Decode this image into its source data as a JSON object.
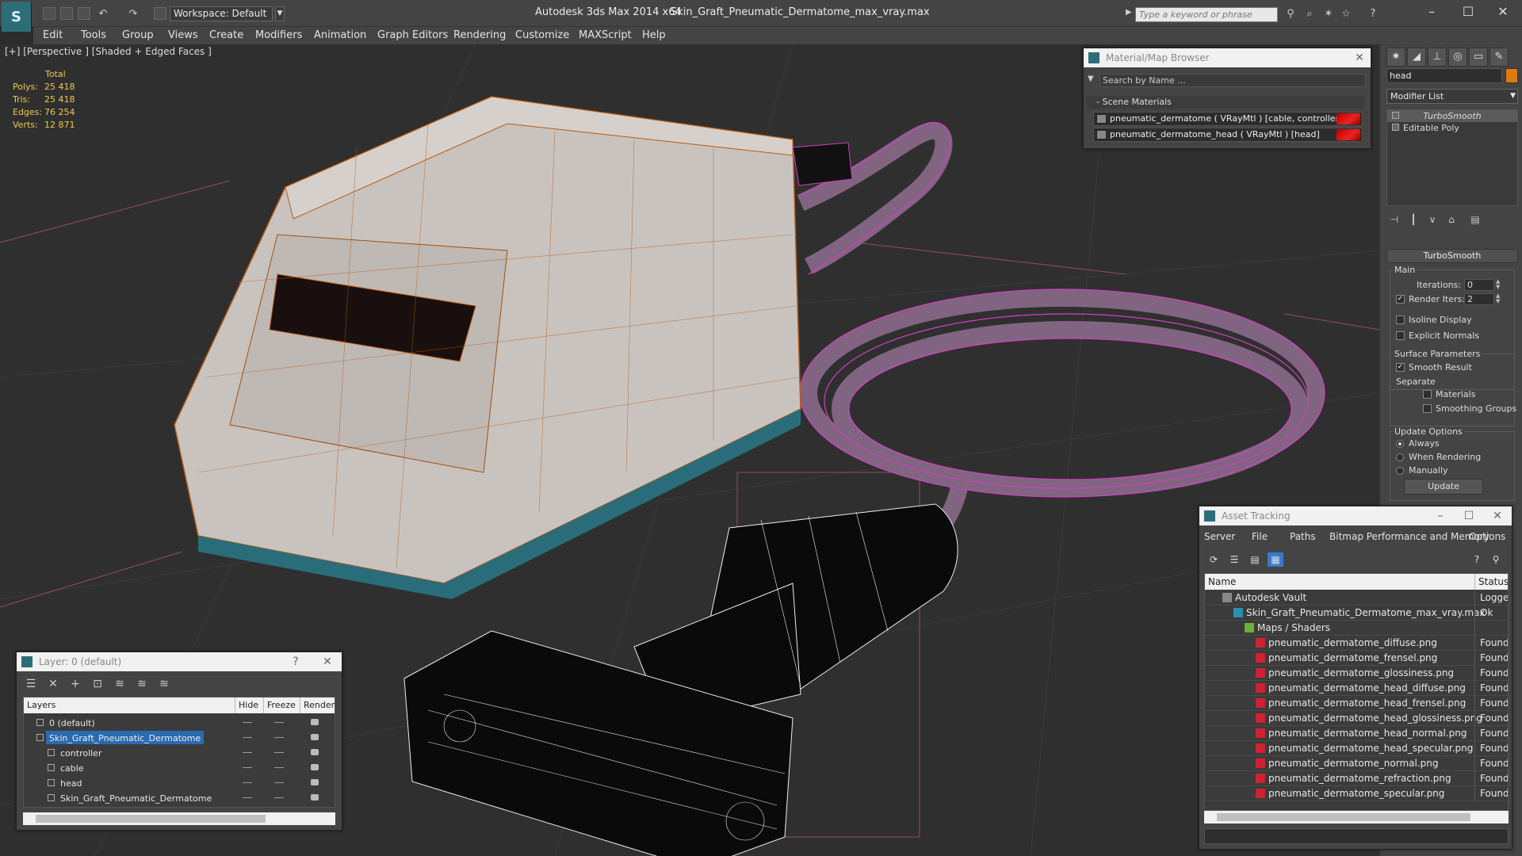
{
  "titlebar": {
    "workspace": "Workspace: Default",
    "app_title": "Autodesk 3ds Max  2014 x64",
    "file_title": "Skin_Graft_Pneumatic_Dermatome_max_vray.max",
    "search_placeholder": "Type a keyword or phrase"
  },
  "menu": [
    "Edit",
    "Tools",
    "Group",
    "Views",
    "Create",
    "Modifiers",
    "Animation",
    "Graph Editors",
    "Rendering",
    "Customize",
    "MAXScript",
    "Help"
  ],
  "viewport": {
    "label": "[+] [Perspective ] [Shaded + Edged Faces ]",
    "stats": {
      "header": "Total",
      "rows": [
        {
          "k": "Polys:",
          "v": "25 418"
        },
        {
          "k": "Tris:",
          "v": "25 418"
        },
        {
          "k": "Edges:",
          "v": "76 254"
        },
        {
          "k": "Verts:",
          "v": "12 871"
        }
      ]
    }
  },
  "command_panel": {
    "object_name": "head",
    "object_color": "#e07a10",
    "modifier_list": "Modifier List",
    "stack": [
      "TurboSmooth",
      "Editable Poly"
    ],
    "rollout": "TurboSmooth",
    "main_group": "Main",
    "iterations_label": "Iterations:",
    "iterations_value": "0",
    "render_iters_label": "Render Iters:",
    "render_iters_value": "2",
    "render_iters_checked": true,
    "isoline_label": "Isoline Display",
    "explicit_label": "Explicit Normals",
    "surface_group": "Surface Parameters",
    "smooth_label": "Smooth Result",
    "separate_label": "Separate",
    "materials_label": "Materials",
    "smoothing_label": "Smoothing Groups",
    "update_group": "Update Options",
    "always_label": "Always",
    "when_rendering_label": "When Rendering",
    "manually_label": "Manually",
    "update_button": "Update"
  },
  "material_browser": {
    "title": "Material/Map Browser",
    "search_placeholder": "Search by Name ...",
    "section": "- Scene Materials",
    "items": [
      "pneumatic_dermatome  ( VRayMtl )  [cable, controller]",
      "pneumatic_dermatome_head  ( VRayMtl )  [head]"
    ]
  },
  "layer_panel": {
    "title": "Layer: 0 (default)",
    "help": "?",
    "columns": {
      "layers": "Layers",
      "hide": "Hide",
      "freeze": "Freeze",
      "render": "Render"
    },
    "rows": [
      {
        "name": "0 (default)",
        "indent": 0
      },
      {
        "name": "Skin_Graft_Pneumatic_Dermatome",
        "indent": 0
      },
      {
        "name": "controller",
        "indent": 1
      },
      {
        "name": "cable",
        "indent": 1
      },
      {
        "name": "head",
        "indent": 1
      },
      {
        "name": "Skin_Graft_Pneumatic_Dermatome",
        "indent": 1
      }
    ]
  },
  "asset_tracking": {
    "title": "Asset Tracking",
    "menu": [
      "Server",
      "File",
      "Paths",
      "Bitmap Performance and Memory",
      "Options"
    ],
    "columns": {
      "name": "Name",
      "status": "Status"
    },
    "rows": [
      {
        "name": "Autodesk Vault",
        "status": "Logged",
        "indent": 1
      },
      {
        "name": "Skin_Graft_Pneumatic_Dermatome_max_vray.max",
        "status": "Ok",
        "indent": 2
      },
      {
        "name": "Maps / Shaders",
        "status": "",
        "indent": 3
      },
      {
        "name": "pneumatic_dermatome_diffuse.png",
        "status": "Found",
        "indent": 4
      },
      {
        "name": "pneumatic_dermatome_frensel.png",
        "status": "Found",
        "indent": 4
      },
      {
        "name": "pneumatic_dermatome_glossiness.png",
        "status": "Found",
        "indent": 4
      },
      {
        "name": "pneumatic_dermatome_head_diffuse.png",
        "status": "Found",
        "indent": 4
      },
      {
        "name": "pneumatic_dermatome_head_frensel.png",
        "status": "Found",
        "indent": 4
      },
      {
        "name": "pneumatic_dermatome_head_glossiness.png",
        "status": "Found",
        "indent": 4
      },
      {
        "name": "pneumatic_dermatome_head_normal.png",
        "status": "Found",
        "indent": 4
      },
      {
        "name": "pneumatic_dermatome_head_specular.png",
        "status": "Found",
        "indent": 4
      },
      {
        "name": "pneumatic_dermatome_normal.png",
        "status": "Found",
        "indent": 4
      },
      {
        "name": "pneumatic_dermatome_refraction.png",
        "status": "Found",
        "indent": 4
      },
      {
        "name": "pneumatic_dermatome_specular.png",
        "status": "Found",
        "indent": 4
      }
    ]
  }
}
